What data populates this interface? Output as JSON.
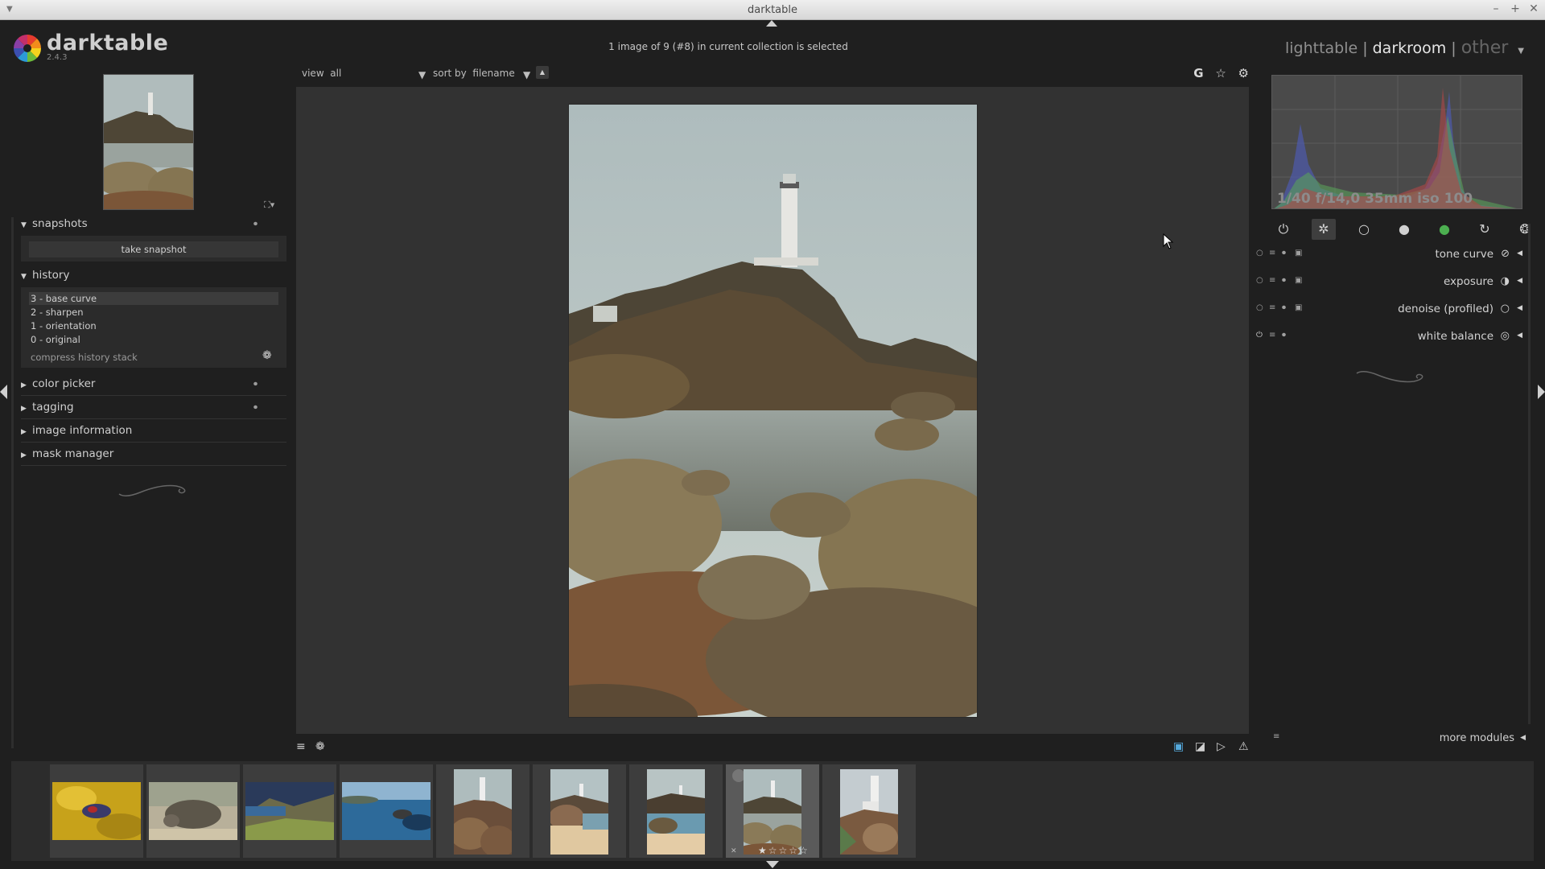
{
  "window": {
    "title": "darktable"
  },
  "header": {
    "app_name": "darktable",
    "version": "2.4.3",
    "collection_status": "1 image of 9 (#8) in current collection is selected",
    "views": {
      "lighttable": "lighttable",
      "darkroom": "darkroom",
      "other": "other",
      "separator": "|"
    }
  },
  "toolbar": {
    "view_label": "view",
    "view_value": "all",
    "sort_label": "sort by",
    "sort_value": "filename",
    "grouping_label": "G"
  },
  "left_panel": {
    "snapshots": {
      "title": "snapshots",
      "take_snapshot": "take snapshot"
    },
    "history": {
      "title": "history",
      "items": [
        "3 - base curve",
        "2 - sharpen",
        "1 - orientation",
        "0 - original"
      ],
      "compress": "compress history stack"
    },
    "color_picker": "color picker",
    "tagging": "tagging",
    "image_information": "image information",
    "mask_manager": "mask manager"
  },
  "right_panel": {
    "exif": "1/40 f/14,0 35mm iso 100",
    "modules": [
      "tone curve",
      "exposure",
      "denoise (profiled)",
      "white balance"
    ],
    "more_modules": "more modules"
  },
  "filmstrip": {
    "selected_index": 7,
    "count": 9
  },
  "icons": {
    "module_groups": [
      "power-icon",
      "favorites-star-icon",
      "basic-circle-icon",
      "tone-circle-icon",
      "color-circle-icon",
      "correct-icon",
      "effect-icon"
    ]
  },
  "colors": {
    "background": "#1f1f1f",
    "center": "#323232",
    "panel_text": "#cfcfcf"
  }
}
